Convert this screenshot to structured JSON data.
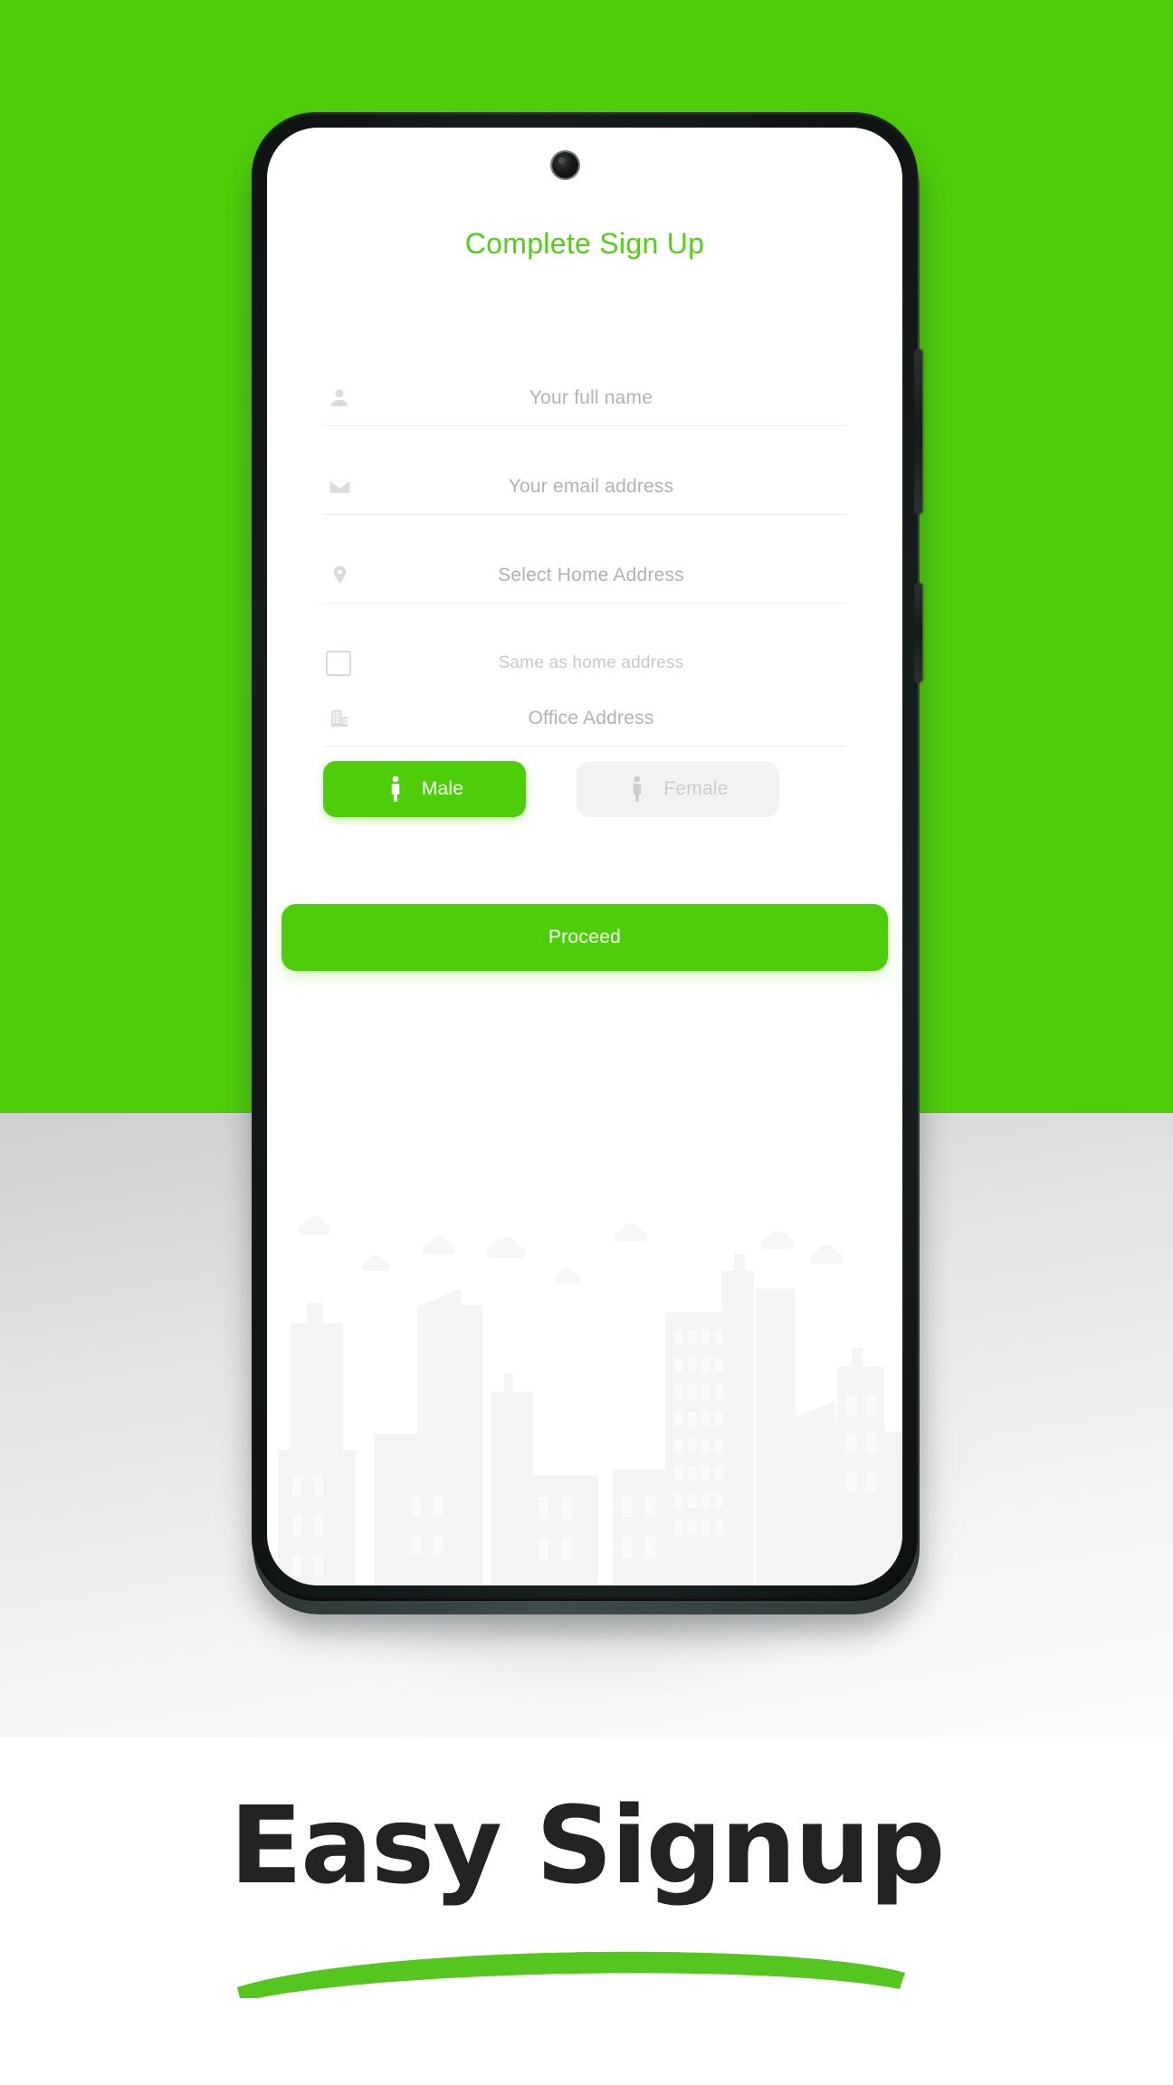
{
  "theme": {
    "accent_green": "#4ECE0A",
    "title_green": "#55CE17",
    "placeholder_gray": "#B2B2B2",
    "caption_color": "#232323",
    "inactive_bg": "#F2F2F2"
  },
  "phone": {
    "camera_icon": "front-camera-icon",
    "buttons": {
      "volume": "volume-rocker",
      "power": "power-button"
    }
  },
  "app": {
    "title": "Complete Sign Up",
    "fields": [
      {
        "icon": "person-icon",
        "placeholder": "Your full name",
        "value": ""
      },
      {
        "icon": "envelope-icon",
        "placeholder": "Your email address",
        "value": ""
      },
      {
        "icon": "location-pin-icon",
        "placeholder": "Select Home Address",
        "value": ""
      },
      {
        "icon": "building-icon",
        "placeholder": "Office  Address",
        "value": ""
      }
    ],
    "checkbox": {
      "label": "Same as home address",
      "checked": false,
      "icon": "checkbox-icon"
    },
    "gender": {
      "selected": "Male",
      "options": [
        {
          "label": "Male",
          "icon": "male-figure-icon",
          "state": "selected"
        },
        {
          "label": "Female",
          "icon": "female-figure-icon",
          "state": "unselected"
        }
      ]
    },
    "submit_label": "Proceed",
    "background_art": "city-skyline-watermark"
  },
  "caption": {
    "text": "Easy Signup",
    "underline": "green-swoosh-underline"
  }
}
